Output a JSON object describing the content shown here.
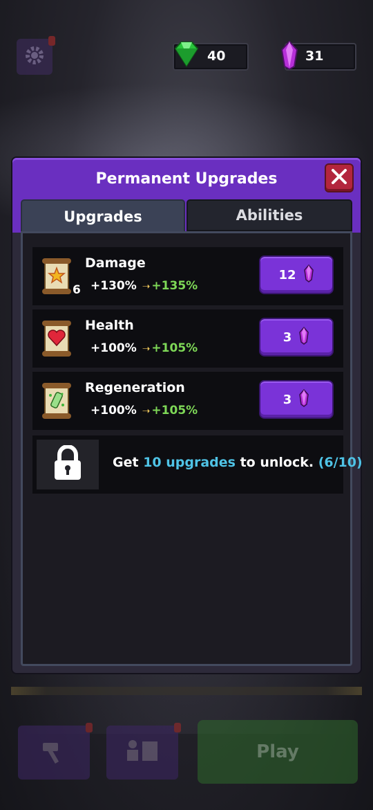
{
  "topbar": {
    "gems": {
      "value": "40",
      "icon": "green-gem-icon"
    },
    "crystals": {
      "value": "31",
      "icon": "purple-crystal-icon"
    }
  },
  "panel": {
    "title": "Permanent Upgrades",
    "tabs": [
      {
        "label": "Upgrades",
        "active": true
      },
      {
        "label": "Abilities",
        "active": false
      }
    ],
    "upgrades": [
      {
        "name": "Damage",
        "level": "6",
        "current": "+130%",
        "next": "+135%",
        "cost": "12",
        "icon": "damage-scroll-icon"
      },
      {
        "name": "Health",
        "level": "",
        "current": "+100%",
        "next": "+105%",
        "cost": "3",
        "icon": "health-scroll-icon"
      },
      {
        "name": "Regeneration",
        "level": "",
        "current": "+100%",
        "next": "+105%",
        "cost": "3",
        "icon": "regeneration-scroll-icon"
      }
    ],
    "lock": {
      "pre": "Get ",
      "highlight": "10 upgrades",
      "post": " to unlock. ",
      "progress": "(6/10)"
    }
  },
  "bottom": {
    "play_label": "Play"
  },
  "colors": {
    "accent": "#6a2fc0",
    "button": "#7a33d8",
    "next_value": "#7ed857",
    "highlight": "#4fc3e6"
  }
}
